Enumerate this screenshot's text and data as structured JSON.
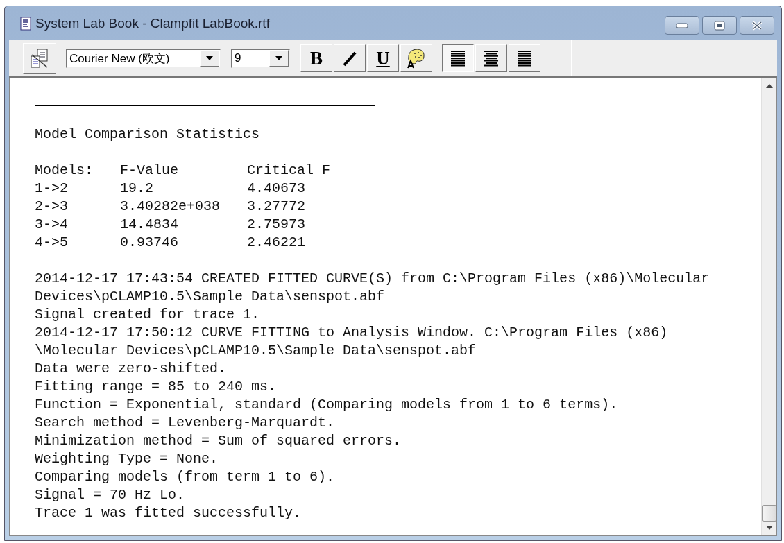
{
  "window": {
    "title": "System Lab Book - Clampfit LabBook.rtf"
  },
  "toolbar": {
    "font": "Courier New (欧文)",
    "size": "9",
    "styles": [
      {
        "kind": "bold",
        "label": "B"
      },
      {
        "kind": "italic"
      },
      {
        "kind": "underline",
        "label": "U"
      },
      {
        "kind": "color"
      }
    ],
    "alignment": [
      {
        "kind": "left",
        "selected": true
      },
      {
        "kind": "center",
        "selected": false
      },
      {
        "kind": "right",
        "selected": false
      }
    ]
  },
  "document": {
    "heading": "Model Comparison Statistics",
    "table": {
      "columns": [
        "Models:",
        "F-Value",
        "Critical F"
      ],
      "rows": [
        [
          "1->2",
          "19.2",
          "4.40673"
        ],
        [
          "2->3",
          "3.40282e+038",
          "3.27772"
        ],
        [
          "3->4",
          "14.4834",
          "2.75973"
        ],
        [
          "4->5",
          "0.93746",
          "2.46221"
        ]
      ]
    },
    "log": [
      "2014-12-17 17:43:54 CREATED FITTED CURVE(S) from C:\\Program Files (x86)\\Molecular",
      "Devices\\pCLAMP10.5\\Sample Data\\senspot.abf",
      "Signal created for trace 1.",
      "2014-12-17 17:50:12 CURVE FITTING to Analysis Window. C:\\Program Files (x86)",
      "\\Molecular Devices\\pCLAMP10.5\\Sample Data\\senspot.abf",
      "Data were zero-shifted.",
      "Fitting range = 85 to 240 ms.",
      "Function = Exponential, standard (Comparing models from 1 to 6 terms).",
      "Search method = Levenberg-Marquardt.",
      "Minimization method = Sum of squared errors.",
      "Weighting Type = None.",
      "Comparing models (from term 1 to 6).",
      "Signal = 70 Hz Lo.",
      "Trace 1 was fitted successfully."
    ]
  }
}
